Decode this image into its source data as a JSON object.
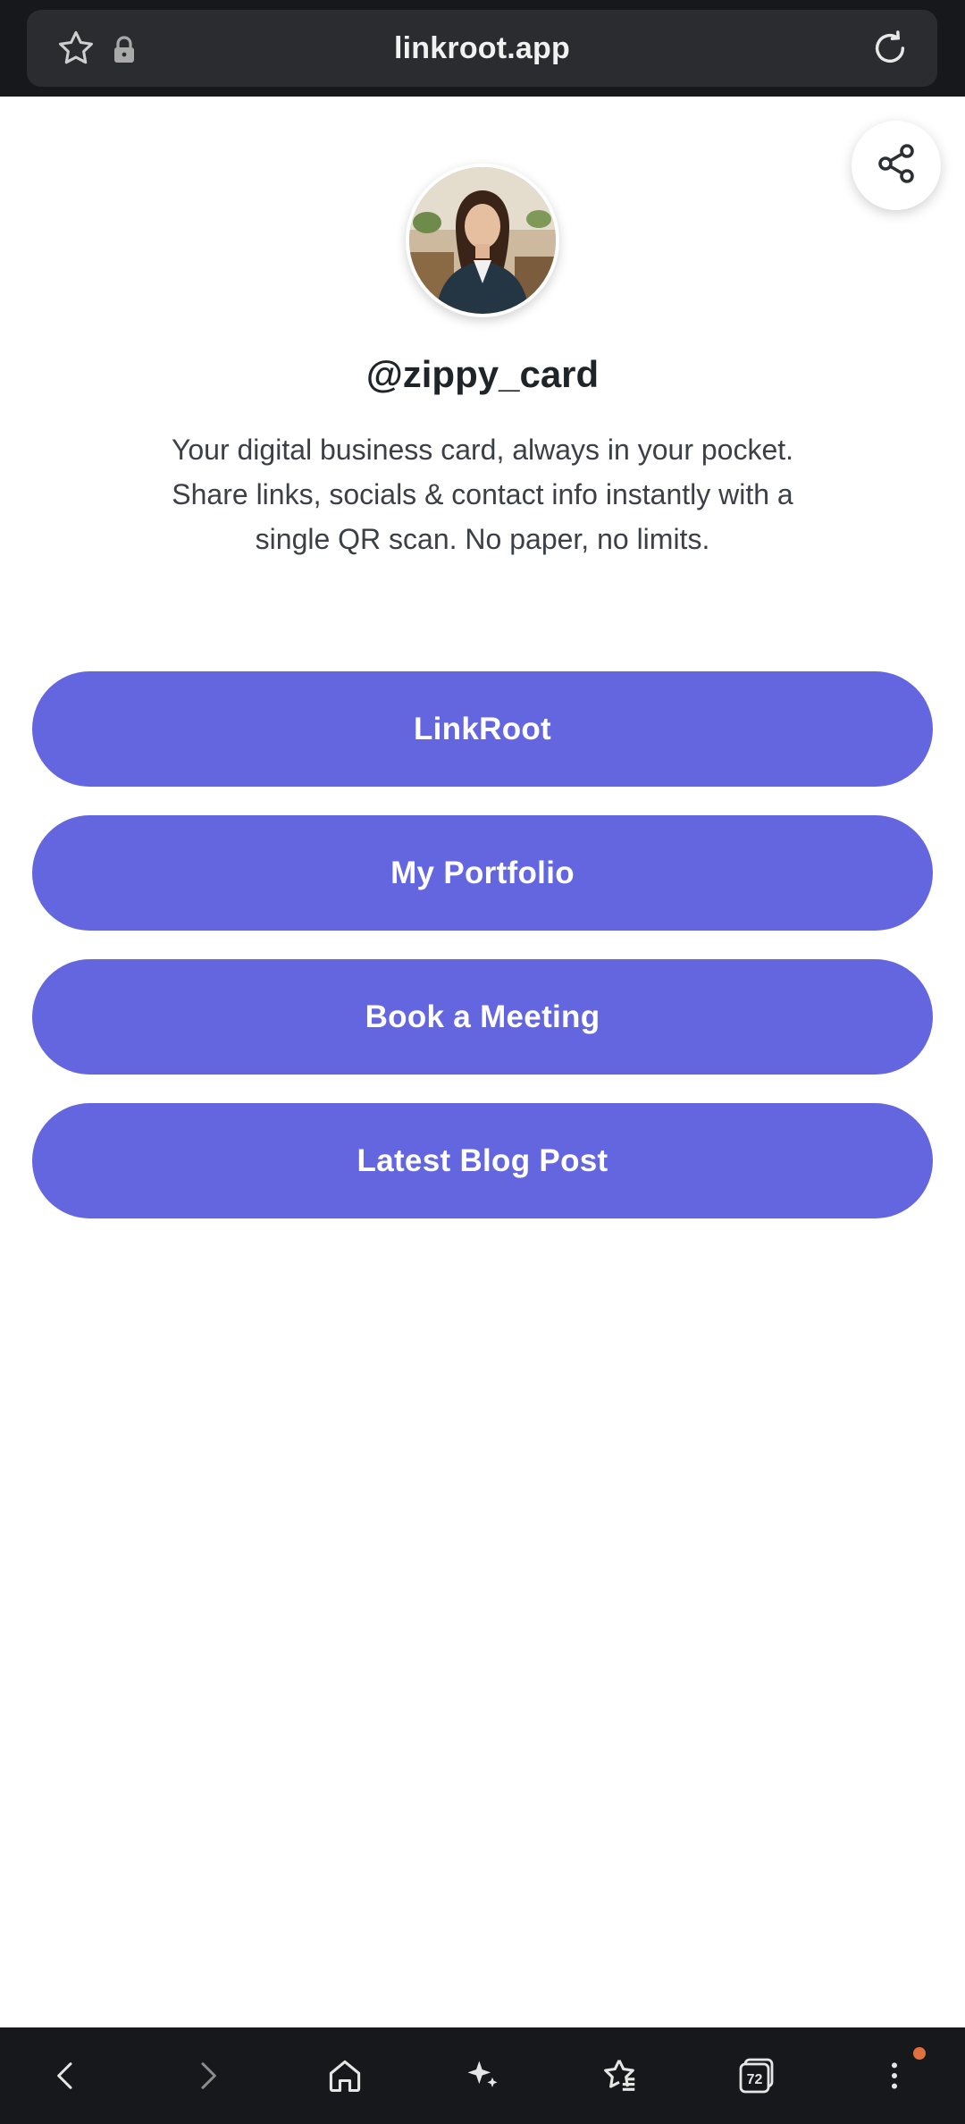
{
  "browser": {
    "url": "linkroot.app",
    "icons": {
      "favorite": "star-outline-icon",
      "security": "lock-icon",
      "reload": "reload-icon"
    }
  },
  "profile": {
    "username": "@zippy_card",
    "bio": "Your digital business card, always in your pocket. Share links, socials & contact info instantly with a single QR scan. No paper, no limits.",
    "share_icon": "share-icon"
  },
  "links": [
    {
      "label": "LinkRoot"
    },
    {
      "label": "My Portfolio"
    },
    {
      "label": "Book a Meeting"
    },
    {
      "label": "Latest Blog Post"
    }
  ],
  "bottom_nav": {
    "tabs_count": "72",
    "items": [
      "back-icon",
      "forward-icon",
      "home-icon",
      "sparkle-icon",
      "bookmarks-icon",
      "tabs-icon",
      "menu-icon"
    ]
  },
  "colors": {
    "accent": "#6366df",
    "browser_chrome": "#17181b",
    "notification": "#e0703e"
  }
}
